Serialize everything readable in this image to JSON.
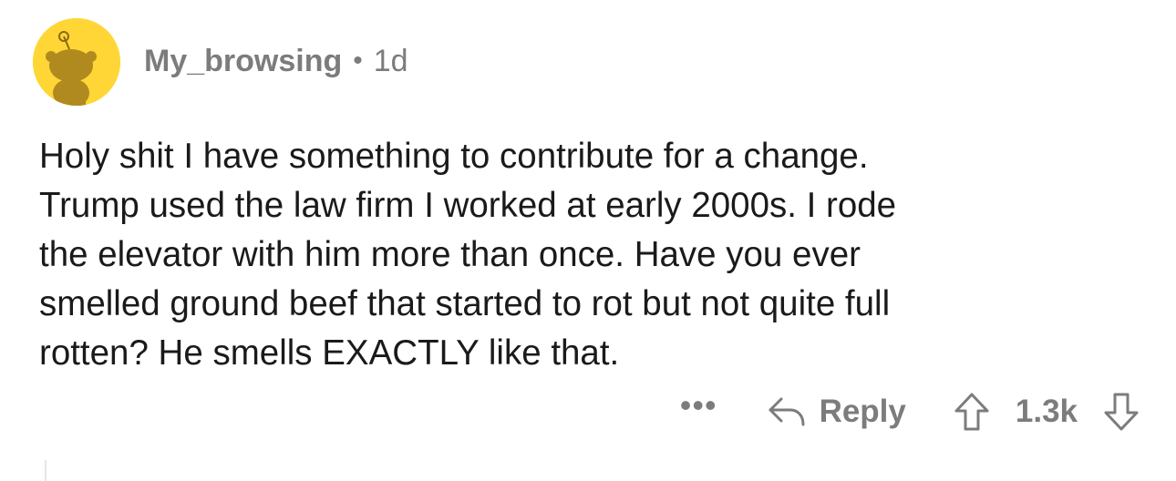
{
  "comment": {
    "username": "My_browsing",
    "separator": "•",
    "age": "1d",
    "body": "Holy shit I have something to contribute for a change.\nTrump used the law firm I worked at early 2000s.  I rode\nthe elevator with him more than once. Have you ever\nsmelled ground beef that started to rot but not quite full\nrotten? He smells EXACTLY like that.",
    "more_label": "•••",
    "reply_label": "Reply",
    "vote_count": "1.3k"
  },
  "icons": {
    "avatar": "snoo-avatar-icon",
    "reply": "reply-arrow-icon",
    "upvote": "upvote-arrow-icon",
    "downvote": "downvote-arrow-icon"
  },
  "colors": {
    "avatar_bg": "#ffd635",
    "meta_text": "#7c7c7c",
    "body_text": "#1a1a1b"
  }
}
